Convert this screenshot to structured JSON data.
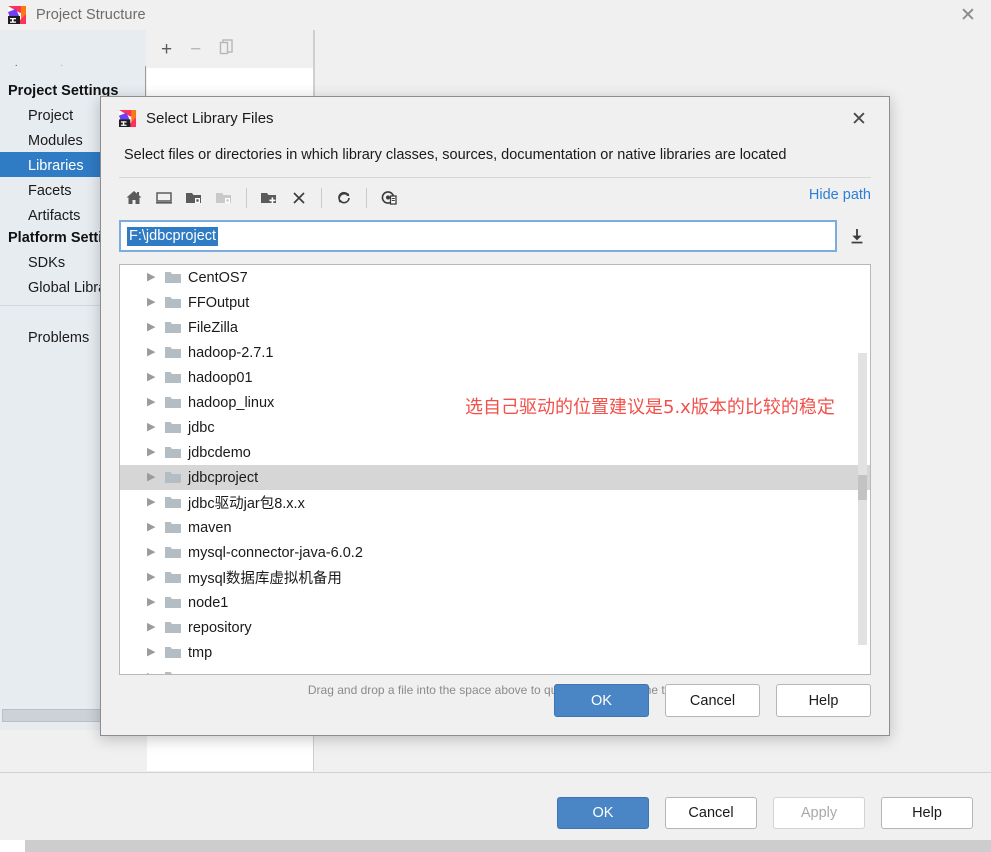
{
  "window": {
    "title": "Project Structure",
    "icon": "intellij-idea-icon",
    "close_label": "✕",
    "nav_back": "←",
    "nav_forward": "→"
  },
  "sidebar": {
    "groups": [
      {
        "label": "Project Settings",
        "items": [
          {
            "label": "Project",
            "selected": false
          },
          {
            "label": "Modules",
            "selected": false
          },
          {
            "label": "Libraries",
            "selected": true
          },
          {
            "label": "Facets",
            "selected": false
          },
          {
            "label": "Artifacts",
            "selected": false
          }
        ]
      },
      {
        "label": "Platform Settings",
        "items": [
          {
            "label": "SDKs",
            "selected": false
          },
          {
            "label": "Global Libraries",
            "selected": false
          }
        ]
      }
    ],
    "footer_item": "Problems"
  },
  "base_toolbar": {
    "add_label": "+",
    "remove_label": "−",
    "copy_label": "copy-icon"
  },
  "base_buttons": [
    {
      "label": "OK",
      "style": "primary",
      "enabled": true
    },
    {
      "label": "Cancel",
      "style": "default",
      "enabled": true
    },
    {
      "label": "Apply",
      "style": "disabled",
      "enabled": false
    },
    {
      "label": "Help",
      "style": "default",
      "enabled": true
    }
  ],
  "dialog": {
    "title": "Select Library Files",
    "icon": "intellij-idea-icon",
    "close_label": "✕",
    "subtitle": "Select files or directories in which library classes, sources, documentation or native libraries are located",
    "toolbar": [
      {
        "name": "home-icon",
        "enabled": true
      },
      {
        "name": "desktop-icon",
        "enabled": true
      },
      {
        "name": "project-folder-icon",
        "enabled": true
      },
      {
        "name": "module-folder-icon",
        "enabled": false
      },
      {
        "name": "new-folder-icon",
        "enabled": true
      },
      {
        "name": "delete-icon",
        "enabled": true
      },
      {
        "name": "refresh-icon",
        "enabled": true
      },
      {
        "name": "show-hidden-icon",
        "enabled": true
      }
    ],
    "hide_path_label": "Hide path",
    "path_value": "F:\\jdbcproject",
    "path_dropdown_icon": "collapse-all-icon",
    "tree": [
      {
        "label": "CentOS7",
        "selected": false
      },
      {
        "label": "FFOutput",
        "selected": false
      },
      {
        "label": "FileZilla",
        "selected": false
      },
      {
        "label": "hadoop-2.7.1",
        "selected": false
      },
      {
        "label": "hadoop01",
        "selected": false
      },
      {
        "label": "hadoop_linux",
        "selected": false
      },
      {
        "label": "jdbc",
        "selected": false
      },
      {
        "label": "jdbcdemo",
        "selected": false
      },
      {
        "label": "jdbcproject",
        "selected": true
      },
      {
        "label": "jdbc驱动jar包8.x.x",
        "selected": false
      },
      {
        "label": "maven",
        "selected": false
      },
      {
        "label": "mysql-connector-java-6.0.2",
        "selected": false
      },
      {
        "label": "mysql数据库虚拟机备用",
        "selected": false
      },
      {
        "label": "node1",
        "selected": false
      },
      {
        "label": "repository",
        "selected": false
      },
      {
        "label": "tmp",
        "selected": false
      }
    ],
    "annotation": "选自己驱动的位置建议是5.x版本的比较的稳定",
    "hint": "Drag and drop a file into the space above to quickly locate it in the tree",
    "buttons": [
      {
        "label": "OK",
        "style": "primary",
        "enabled": true
      },
      {
        "label": "Cancel",
        "style": "default",
        "enabled": true
      },
      {
        "label": "Help",
        "style": "default",
        "enabled": true
      }
    ]
  },
  "colors": {
    "accent": "#2f7bc4",
    "primary_button": "#4a86c5",
    "link": "#2a7fd4",
    "annotation": "#f2504a",
    "sidebar_bg": "#e7ecf1"
  }
}
